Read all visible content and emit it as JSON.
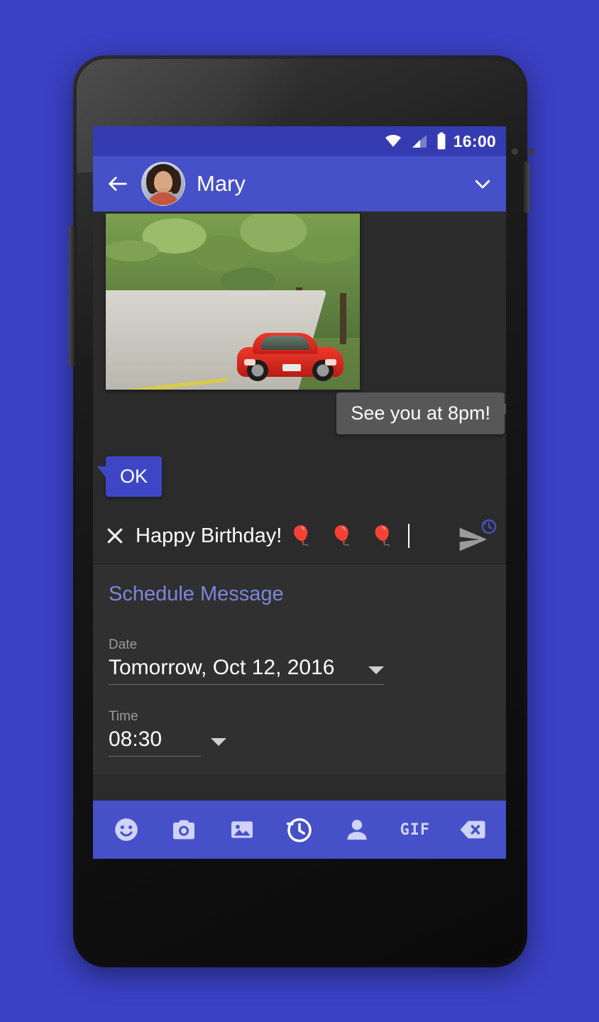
{
  "status_bar": {
    "clock": "16:00",
    "icons": [
      "wifi-icon",
      "signal-icon",
      "battery-icon"
    ]
  },
  "app_bar": {
    "back_icon": "back-arrow-icon",
    "contact_name": "Mary",
    "avatar": "contact-avatar",
    "expand_icon": "chevron-down-icon"
  },
  "conversation": {
    "photo_message": "photo-of-red-sports-car-on-tree-lined-road",
    "messages": [
      {
        "text": "See you at 8pm!",
        "side": "right",
        "color": "#575757"
      },
      {
        "text": "OK",
        "side": "left",
        "color": "#3f46c6"
      }
    ]
  },
  "compose": {
    "close_icon": "close-icon",
    "text": "Happy Birthday!",
    "emoji": "🎈 🎈 🎈",
    "send_icon": "send-icon",
    "schedule_badge_icon": "clock-history-icon"
  },
  "schedule_panel": {
    "title": "Schedule Message",
    "date_label": "Date",
    "date_value": "Tomorrow, Oct 12, 2016",
    "time_label": "Time",
    "time_value": "08:30",
    "dropdown_icon": "caret-down-icon"
  },
  "toolbar": {
    "items": [
      {
        "name": "emoji-icon",
        "label": ""
      },
      {
        "name": "camera-icon",
        "label": ""
      },
      {
        "name": "gallery-icon",
        "label": ""
      },
      {
        "name": "schedule-icon",
        "label": ""
      },
      {
        "name": "contact-icon",
        "label": ""
      },
      {
        "name": "gif-icon",
        "label": "GIF"
      },
      {
        "name": "backspace-icon",
        "label": ""
      }
    ]
  },
  "colors": {
    "background": "#3b41c5",
    "app_bar": "#4650c8",
    "status_bar": "#353bb0",
    "screen_bg": "#2b2b2b",
    "panel_bg": "#303030",
    "accent_text": "#7b86dd",
    "bubble_out": "#575757",
    "bubble_in": "#3f46c6"
  }
}
